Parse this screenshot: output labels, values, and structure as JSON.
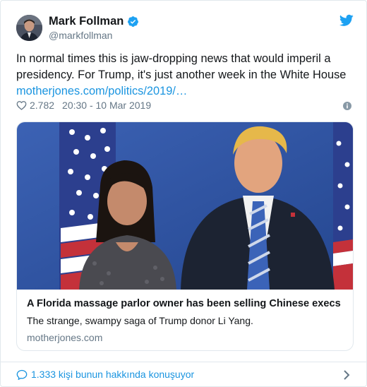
{
  "tweet": {
    "author_name": "Mark Follman",
    "author_handle": "@markfollman",
    "text": "In normal times this is jaw-dropping news that would imperil a presidency. For Trump, it's just another week in the White House",
    "link_text": "motherjones.com/politics/2019/…",
    "likes": "2.782",
    "timestamp": "20:30 - 10 Mar 2019"
  },
  "card": {
    "title": "A Florida massage parlor owner has been selling Chinese execs …",
    "description": "The strange, swampy saga of Trump donor Li Yang.",
    "domain": "motherjones.com"
  },
  "footer": {
    "conversation_text": "1.333 kişi bunun hakkında konuşuyor"
  },
  "icons": {
    "verified": "verified-badge-icon",
    "twitter": "twitter-bird-icon",
    "like": "heart-icon",
    "info": "info-icon",
    "reply": "speech-bubble-icon",
    "more": "chevron-right-icon"
  },
  "colors": {
    "link_blue": "#1b95e0",
    "secondary_gray": "#657786",
    "text": "#14171a",
    "border": "#e1e8ed"
  }
}
